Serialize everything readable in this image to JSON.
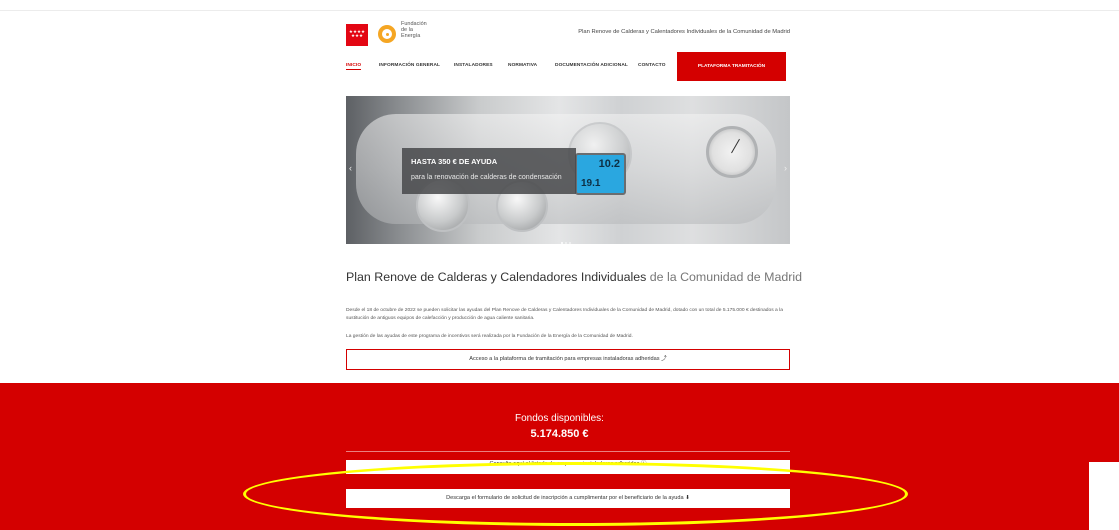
{
  "header": {
    "logo_cm_stars": "★★★★\n★★★",
    "logo_fe_text": "Fundación\nde la\nEnergía",
    "title": "Plan Renove de Calderas y Calentadores Individuales de la Comunidad de Madrid"
  },
  "nav": {
    "items": [
      {
        "label": "INICIO",
        "active": true
      },
      {
        "label": "INFORMACIÓN GENERAL"
      },
      {
        "label": "INSTALADORES"
      },
      {
        "label": "NORMATIVA"
      },
      {
        "label": "DOCUMENTACIÓN ADICIONAL"
      },
      {
        "label": "CONTACTO"
      }
    ],
    "cta": "PLATAFORMA TRAMITACIÓN"
  },
  "hero": {
    "heading": "HASTA 350 € DE AYUDA",
    "subheading": "para la renovación de calderas de condensación",
    "lcd_top": "10.2",
    "lcd_bottom": "19.1",
    "prev": "‹",
    "next": "›"
  },
  "content": {
    "title_bold": "Plan Renove de Calderas y Calendadores Individuales",
    "title_light": " de la Comunidad de Madrid",
    "paragraph1": "Desde el 18 de octubre de 2022 se pueden solicitar las ayudas del Plan Renove de Calderas y Calentadores Individuales de la Comunidad de Madrid, dotado con un total de 5.175.000 € destinados a la sustitución de antiguos equipos de calefacción y producción de agua caliente sanitaria.",
    "paragraph2": "La gestión de las ayudas de este programa de incentivos será realizada por la Fundación de la Energía de la Comunidad de Madrid.",
    "platform_button": "Acceso a la plataforma de tramitación para empresas instaladoras adheridas ⤴"
  },
  "funds": {
    "label": "Fondos disponibles:",
    "value": "5.174.850 €",
    "installers_button": "Consulte aquí el listado de empresas instaladoras adheridas ⓘ",
    "form_button": "Descarga el formulario de solicitud de inscripción a cumplimentar por el beneficiario de la ayuda ⬇"
  },
  "colors": {
    "brand_red": "#d40000",
    "highlight": "#ffff00"
  }
}
